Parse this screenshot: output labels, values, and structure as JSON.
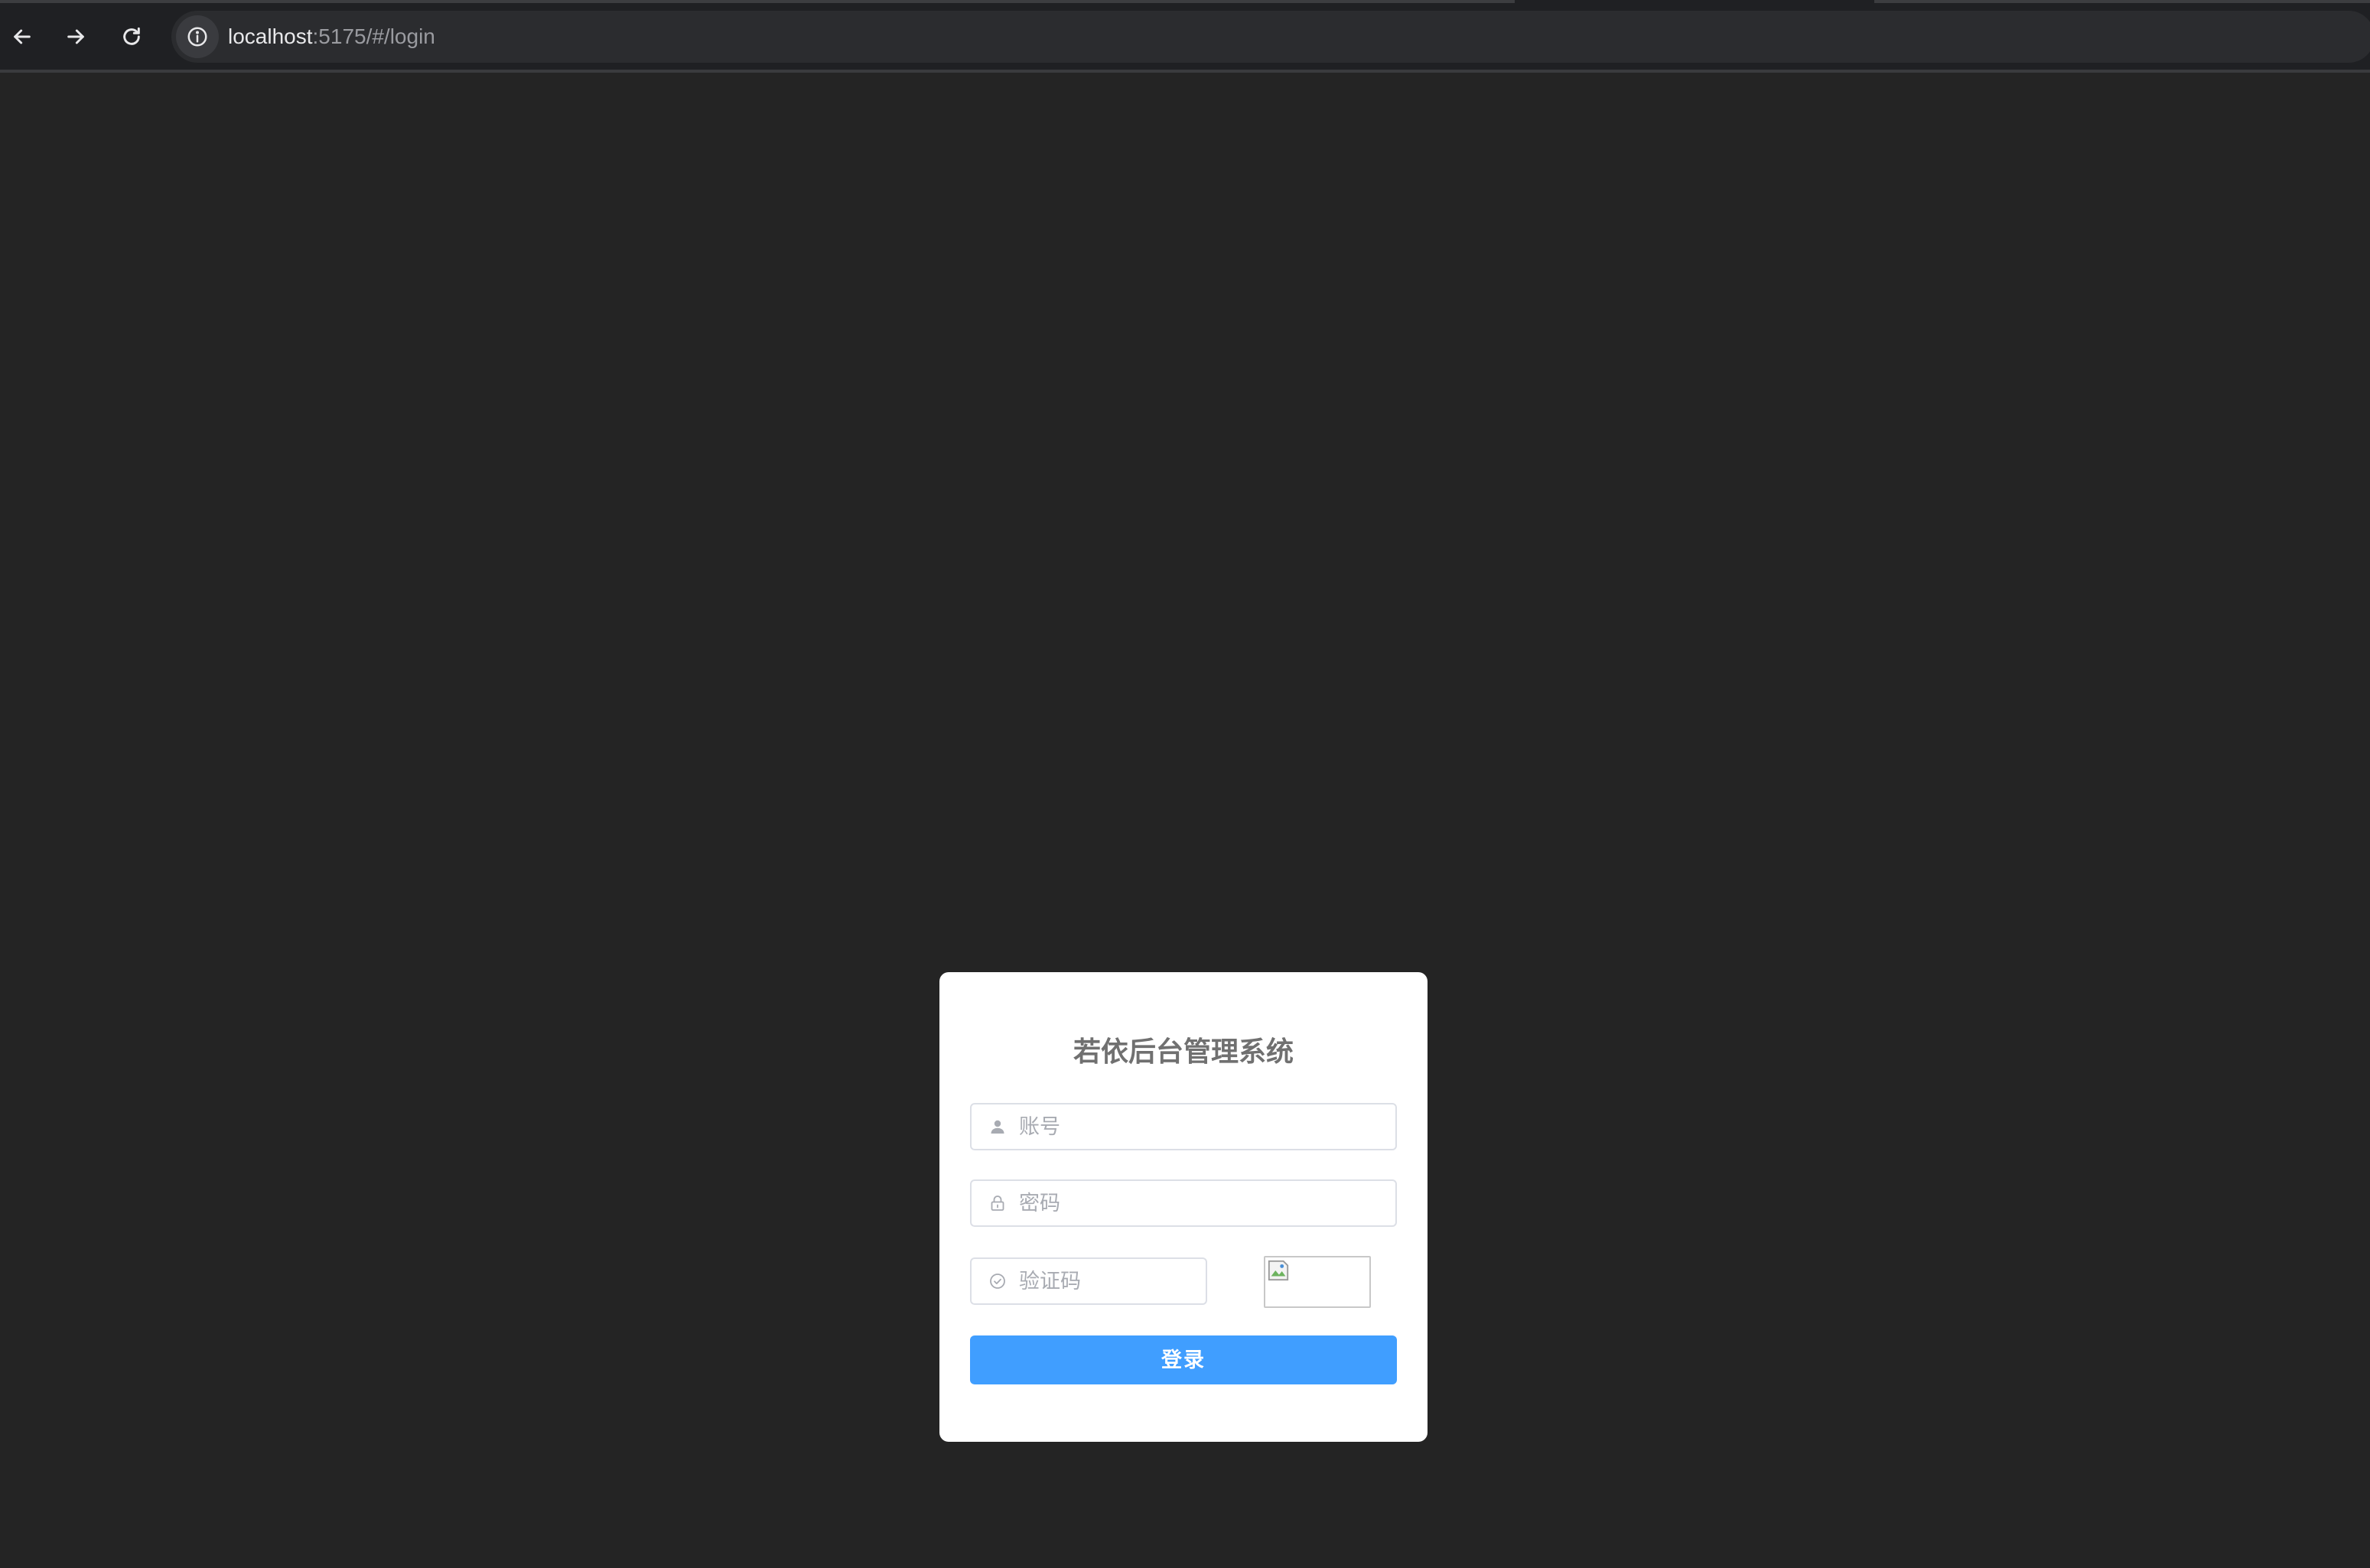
{
  "browser": {
    "url_host": "localhost",
    "url_rest": ":5175/#/login",
    "back_icon": "arrow-left-icon",
    "forward_icon": "arrow-right-icon",
    "reload_icon": "reload-icon",
    "site_info_icon": "info-circle-icon"
  },
  "login": {
    "title": "若依后台管理系统",
    "username": {
      "placeholder": "账号",
      "value": "",
      "icon": "user-icon"
    },
    "password": {
      "placeholder": "密码",
      "value": "",
      "icon": "lock-icon"
    },
    "captcha": {
      "placeholder": "验证码",
      "value": "",
      "icon": "circle-check-icon",
      "image_icon": "broken-image-icon"
    },
    "submit_label": "登录"
  },
  "colors": {
    "page_background": "#242424",
    "chrome_background": "#1f2023",
    "card_background": "#ffffff",
    "title_text": "#707070",
    "button_primary": "#409eff",
    "input_border": "#dcdfe6",
    "placeholder_text": "#a8abb2"
  }
}
